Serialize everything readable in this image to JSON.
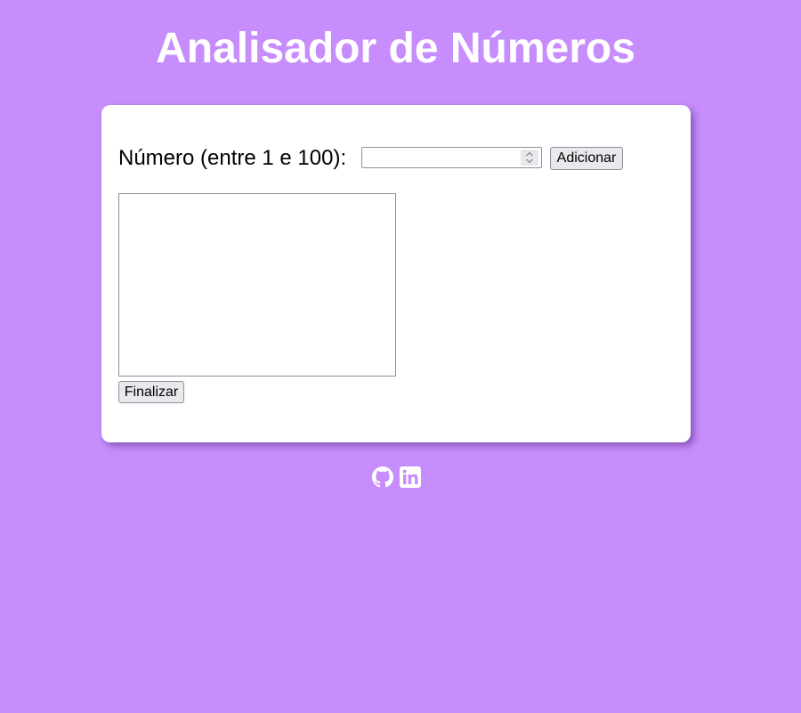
{
  "header": {
    "title": "Analisador de Números"
  },
  "form": {
    "number_label": "Número (entre 1 e 100):",
    "number_value": "",
    "add_button": "Adicionar",
    "list_items": [],
    "finish_button": "Finalizar"
  },
  "footer": {
    "icons": [
      "github-icon",
      "linkedin-icon"
    ]
  },
  "colors": {
    "background": "#c78dfd",
    "card": "#ffffff",
    "title_text": "#ffffff",
    "icon": "#ffffff"
  }
}
